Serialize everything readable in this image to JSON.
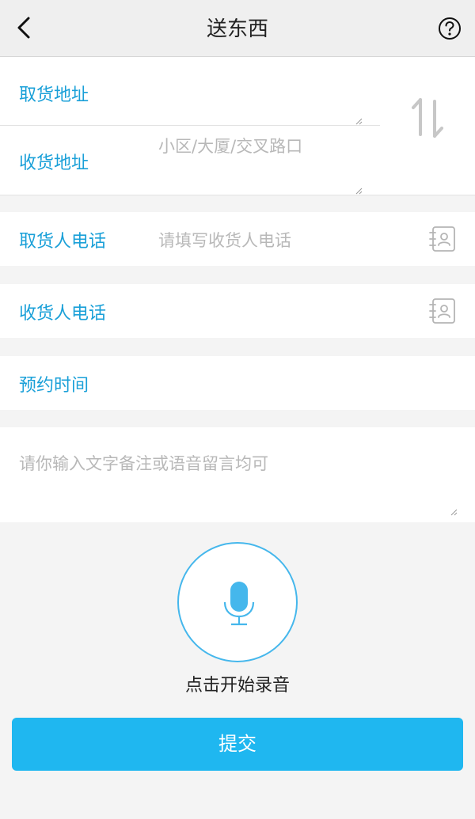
{
  "header": {
    "title": "送东西",
    "back_icon": "chevron-left-icon",
    "help_icon": "question-circle-icon"
  },
  "address": {
    "pickup_label": "取货地址",
    "delivery_label": "收货地址",
    "delivery_placeholder": "小区/大厦/交叉路口",
    "swap_icon": "swap-vertical-icon"
  },
  "pickup_phone": {
    "label": "取货人电话",
    "placeholder": "请填写收货人电话",
    "contact_icon": "contact-book-icon"
  },
  "delivery_phone": {
    "label": "收货人电话",
    "contact_icon": "contact-book-icon"
  },
  "appointment": {
    "label": "预约时间"
  },
  "note": {
    "placeholder": "请你输入文字备注或语音留言均可"
  },
  "voice": {
    "icon": "microphone-icon",
    "label": "点击开始录音"
  },
  "submit": {
    "label": "提交"
  },
  "colors": {
    "accent": "#1aa0d8",
    "button": "#1fb7f0",
    "mic_ring": "#45b7ec",
    "placeholder": "#b8b8b8",
    "background": "#f4f4f4"
  }
}
